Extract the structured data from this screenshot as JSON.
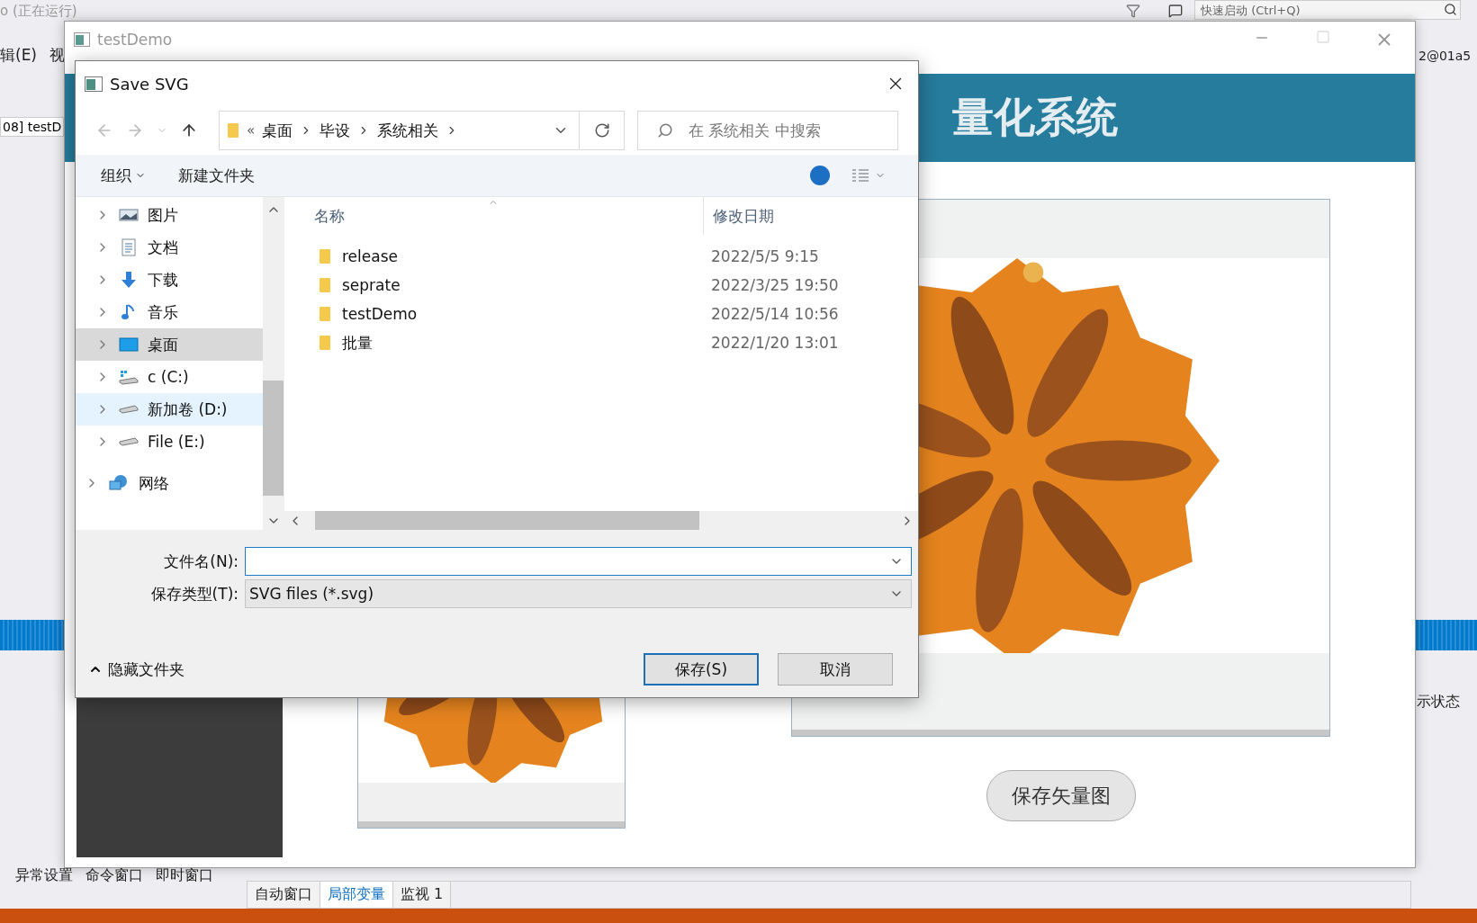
{
  "ide": {
    "title": "o (正在运行)",
    "quick_launch": {
      "placeholder": "快速启动 (Ctrl+Q)"
    },
    "menu": [
      "辑(E)",
      "视"
    ],
    "doc_tab": "08] testD",
    "account": "2@01a5",
    "status_text": "示状态",
    "tool_tabs": [
      "异常设置",
      "命令窗口",
      "即时窗口"
    ],
    "debug_tabs": [
      {
        "label": "自动窗口",
        "selected": false
      },
      {
        "label": "局部变量",
        "selected": true
      },
      {
        "label": "监视 1",
        "selected": false
      }
    ]
  },
  "app_window": {
    "title": "testDemo",
    "banner_title": "量化系统",
    "save_button": "保存矢量图"
  },
  "dialog": {
    "title": "Save SVG",
    "overflow": "«",
    "breadcrumb": [
      "桌面",
      "毕设",
      "系统相关"
    ],
    "search": {
      "placeholder": "在 系统相关 中搜索"
    },
    "toolbar": {
      "organize": "组织",
      "new_folder": "新建文件夹"
    },
    "nav_tree": [
      {
        "label": "图片",
        "kind": "pictures",
        "selected": false,
        "hovered": false
      },
      {
        "label": "文档",
        "kind": "documents",
        "selected": false,
        "hovered": false
      },
      {
        "label": "下载",
        "kind": "downloads",
        "selected": false,
        "hovered": false
      },
      {
        "label": "音乐",
        "kind": "music",
        "selected": false,
        "hovered": false
      },
      {
        "label": "桌面",
        "kind": "desktop",
        "selected": true,
        "hovered": false
      },
      {
        "label": "c (C:)",
        "kind": "system_drive",
        "selected": false,
        "hovered": false
      },
      {
        "label": "新加卷 (D:)",
        "kind": "drive",
        "selected": false,
        "hovered": true
      },
      {
        "label": "File (E:)",
        "kind": "drive",
        "selected": false,
        "hovered": false
      }
    ],
    "network": {
      "label": "网络"
    },
    "columns": [
      "名称",
      "修改日期"
    ],
    "files": [
      {
        "name": "release",
        "modified": "2022/5/5 9:15",
        "selected": false
      },
      {
        "name": "seprate",
        "modified": "2022/3/25 19:50",
        "selected": false
      },
      {
        "name": "testDemo",
        "modified": "2022/5/14 10:56",
        "selected": false
      },
      {
        "name": "批量",
        "modified": "2022/1/20 13:01",
        "selected": false
      }
    ],
    "filename": {
      "label": "文件名(N):"
    },
    "file_type": {
      "label": "保存类型(T):",
      "value": "SVG files (*.svg)"
    },
    "hide_folders": "隐藏文件夹",
    "buttons": [
      {
        "label": "保存(S)",
        "kind": "primary"
      },
      {
        "label": "取消",
        "kind": "secondary"
      }
    ]
  }
}
